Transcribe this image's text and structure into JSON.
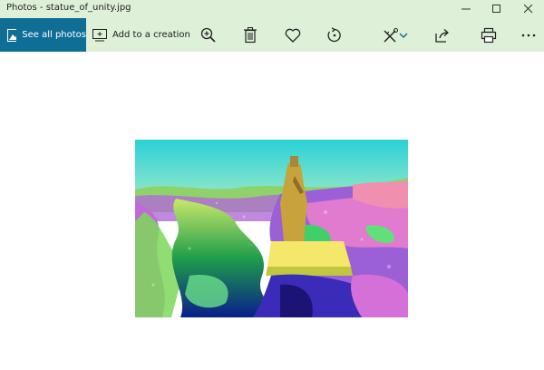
{
  "window": {
    "title": "Photos - statue_of_unity.jpg",
    "controls": [
      "minimize-icon",
      "maximize-icon",
      "close-icon"
    ]
  },
  "toolbar": {
    "see_all_label": "See all photos",
    "add_creation_label": "Add to a creation",
    "icons": [
      "zoom-in-icon",
      "delete-icon",
      "favorite-icon",
      "rotate-icon",
      "edit-icon",
      "chevron-down-icon",
      "share-icon",
      "print-icon",
      "more-icon"
    ]
  },
  "colors": {
    "titlebar_bg": "#dff0d8",
    "accent": "#0f6e96"
  }
}
